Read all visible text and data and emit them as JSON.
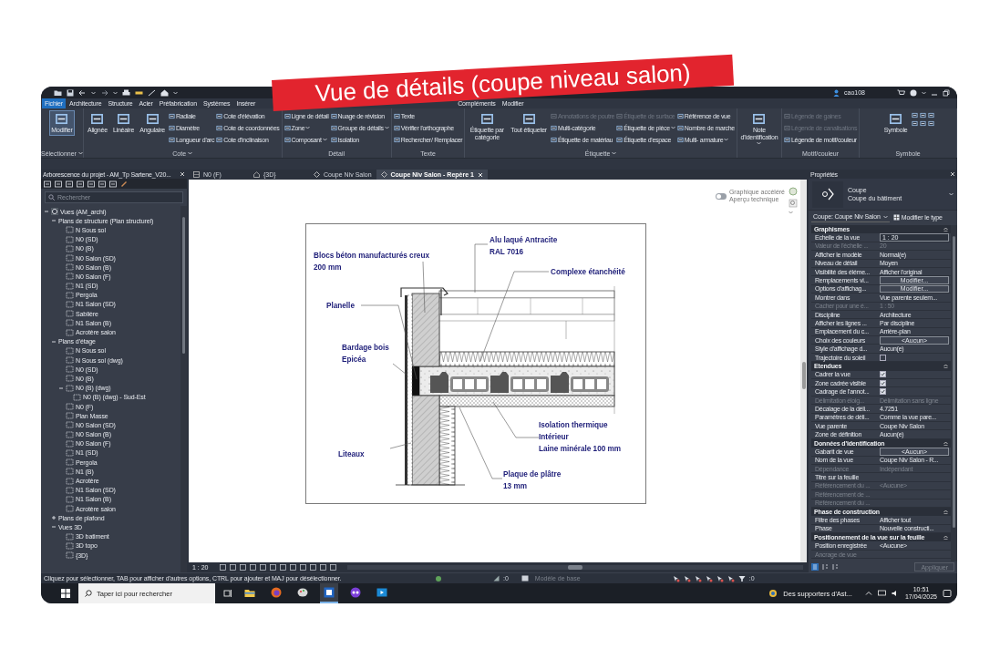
{
  "banner": "Vue de détails (coupe niveau salon)",
  "quick_access": {
    "user": "cao108"
  },
  "menu_tabs": [
    {
      "label": "Fichier",
      "selected": true
    },
    {
      "label": "Architecture",
      "selected": false
    },
    {
      "label": "Structure",
      "selected": false
    },
    {
      "label": "Acier",
      "selected": false
    },
    {
      "label": "Préfabrication",
      "selected": false
    },
    {
      "label": "Systèmes",
      "selected": false
    },
    {
      "label": "Insérer",
      "selected": false
    }
  ],
  "context_tabs": [
    {
      "label": "Compléments",
      "selected": false
    },
    {
      "label": "Modifier",
      "selected": false
    }
  ],
  "ribbon": [
    {
      "title": "Sélectionner",
      "dropdown": true,
      "buttons": [
        {
          "label": "Modifier",
          "kind": "large",
          "active": true,
          "disabled": false,
          "dropdown": false
        }
      ]
    },
    {
      "title": "Cote",
      "dropdown": true,
      "buttons": [
        {
          "label": "Alignée",
          "kind": "large",
          "active": false,
          "disabled": false,
          "dropdown": false
        },
        {
          "label": "Linéaire",
          "kind": "large",
          "active": false,
          "disabled": false,
          "dropdown": false
        },
        {
          "label": "Angulaire",
          "kind": "large",
          "active": false,
          "disabled": false,
          "dropdown": false
        },
        {
          "label": "Radiale",
          "kind": "small",
          "active": false,
          "disabled": false,
          "dropdown": false
        },
        {
          "label": "Diamètre",
          "kind": "small",
          "active": false,
          "disabled": false,
          "dropdown": false
        },
        {
          "label": "Longueur d'arc",
          "kind": "small",
          "active": false,
          "disabled": false,
          "dropdown": false
        },
        {
          "label": "Cote d'élévation",
          "kind": "small",
          "active": false,
          "disabled": false,
          "dropdown": false
        },
        {
          "label": "Cote de coordonnées",
          "kind": "small",
          "active": false,
          "disabled": false,
          "dropdown": false
        },
        {
          "label": "Cote d'inclinaison",
          "kind": "small",
          "active": false,
          "disabled": false,
          "dropdown": false
        }
      ]
    },
    {
      "title": "Détail",
      "dropdown": false,
      "buttons": [
        {
          "label": "Ligne de détail",
          "kind": "small",
          "active": false,
          "disabled": false,
          "dropdown": false
        },
        {
          "label": "Zone",
          "kind": "small",
          "active": false,
          "disabled": false,
          "dropdown": true
        },
        {
          "label": "Composant",
          "kind": "small",
          "active": false,
          "disabled": false,
          "dropdown": true
        },
        {
          "label": "Nuage de révision",
          "kind": "small",
          "active": false,
          "disabled": false,
          "dropdown": false
        },
        {
          "label": "Groupe de détails",
          "kind": "small",
          "active": false,
          "disabled": false,
          "dropdown": true
        },
        {
          "label": "Isolation",
          "kind": "small",
          "active": false,
          "disabled": false,
          "dropdown": false
        }
      ]
    },
    {
      "title": "Texte",
      "dropdown": false,
      "buttons": [
        {
          "label": "Texte",
          "kind": "small",
          "active": false,
          "disabled": false,
          "dropdown": false
        },
        {
          "label": "Vérifier l'orthographe",
          "kind": "small",
          "active": false,
          "disabled": false,
          "dropdown": false
        },
        {
          "label": "Rechercher/ Remplacer",
          "kind": "small",
          "active": false,
          "disabled": false,
          "dropdown": false
        }
      ]
    },
    {
      "title": "Étiquette",
      "dropdown": true,
      "buttons": [
        {
          "label": "Étiquette par catégorie",
          "kind": "large",
          "active": false,
          "disabled": false,
          "dropdown": false
        },
        {
          "label": "Tout étiqueter",
          "kind": "large",
          "active": false,
          "disabled": false,
          "dropdown": false
        },
        {
          "label": "Annotations de poutre",
          "kind": "small",
          "active": false,
          "disabled": true,
          "dropdown": false
        },
        {
          "label": "Multi-catégorie",
          "kind": "small",
          "active": false,
          "disabled": false,
          "dropdown": false
        },
        {
          "label": "Étiquette de matériau",
          "kind": "small",
          "active": false,
          "disabled": false,
          "dropdown": false
        },
        {
          "label": "Étiquette de surface",
          "kind": "small",
          "active": false,
          "disabled": true,
          "dropdown": false
        },
        {
          "label": "Étiquette de pièce",
          "kind": "small",
          "active": false,
          "disabled": false,
          "dropdown": true
        },
        {
          "label": "Étiquette d'espace",
          "kind": "small",
          "active": false,
          "disabled": false,
          "dropdown": false
        },
        {
          "label": "Référence de vue",
          "kind": "small",
          "active": false,
          "disabled": false,
          "dropdown": false
        },
        {
          "label": "Nombre de marche",
          "kind": "small",
          "active": false,
          "disabled": false,
          "dropdown": false
        },
        {
          "label": "Multi- armature",
          "kind": "small",
          "active": false,
          "disabled": false,
          "dropdown": true
        }
      ]
    },
    {
      "buttons": [
        {
          "label": "Note d'identification",
          "kind": "large",
          "active": false,
          "disabled": false,
          "dropdown": true
        }
      ]
    },
    {
      "title": "Motif/couleur",
      "dropdown": false,
      "buttons": [
        {
          "label": "Légende de gaines",
          "kind": "small",
          "active": false,
          "disabled": true,
          "dropdown": false
        },
        {
          "label": "Légende de canalisations",
          "kind": "small",
          "active": false,
          "disabled": true,
          "dropdown": false
        },
        {
          "label": "Légende de motif/couleur",
          "kind": "small",
          "active": false,
          "disabled": false,
          "dropdown": false
        }
      ]
    },
    {
      "title": "Symbole",
      "dropdown": false,
      "buttons": [
        {
          "label": "Symbole",
          "kind": "large",
          "active": false,
          "disabled": false,
          "dropdown": false
        }
      ]
    }
  ],
  "project_browser": {
    "title": "Arborescence du projet - AM_Tp Sartene_V20...",
    "search": {
      "placeholder": "Rechercher"
    },
    "tree": [
      {
        "label": "Vues (AM_archi)",
        "kind": "root",
        "expanded": true,
        "children": [
          {
            "label": "Plans de structure (Plan structurel)",
            "expanded": true,
            "children": [
              {
                "label": "N Sous sol",
                "kind": "view"
              },
              {
                "label": "N0 (SD)",
                "kind": "view"
              },
              {
                "label": "N0 (B)",
                "kind": "view"
              },
              {
                "label": "N0 Salon (SD)",
                "kind": "view"
              },
              {
                "label": "N0 Salon (B)",
                "kind": "view"
              },
              {
                "label": "N0 Salon (F)",
                "kind": "view"
              },
              {
                "label": "N1 (SD)",
                "kind": "view"
              },
              {
                "label": "Pergola",
                "kind": "view"
              },
              {
                "label": "N1 Salon (SD)",
                "kind": "view"
              },
              {
                "label": "Sablière",
                "kind": "view"
              },
              {
                "label": "N1 Salon (B)",
                "kind": "view"
              },
              {
                "label": "Acrotère salon",
                "kind": "view"
              }
            ]
          },
          {
            "label": "Plans d'étage",
            "expanded": true,
            "children": [
              {
                "label": "N Sous sol",
                "kind": "view"
              },
              {
                "label": "N Sous sol (dwg)",
                "kind": "view"
              },
              {
                "label": "N0 (SD)",
                "kind": "view"
              },
              {
                "label": "N0 (B)",
                "kind": "view"
              },
              {
                "label": "N0 (B) (dwg)",
                "kind": "view",
                "expanded": true,
                "children": [
                  {
                    "label": "N0 (B) (dwg) - Sud-Est",
                    "kind": "view"
                  }
                ]
              },
              {
                "label": "N0 (F)",
                "kind": "view"
              },
              {
                "label": "Plan Masse",
                "kind": "view"
              },
              {
                "label": "N0 Salon (SD)",
                "kind": "view"
              },
              {
                "label": "N0 Salon (B)",
                "kind": "view"
              },
              {
                "label": "N0 Salon (F)",
                "kind": "view"
              },
              {
                "label": "N1 (SD)",
                "kind": "view"
              },
              {
                "label": "Pergola",
                "kind": "view"
              },
              {
                "label": "N1 (B)",
                "kind": "view"
              },
              {
                "label": "Acrotère",
                "kind": "view"
              },
              {
                "label": "N1 Salon (SD)",
                "kind": "view"
              },
              {
                "label": "N1 Salon (B)",
                "kind": "view"
              },
              {
                "label": "Acrotère salon",
                "kind": "view"
              }
            ]
          },
          {
            "label": "Plans de plafond",
            "expanded": false
          },
          {
            "label": "Vues 3D",
            "expanded": true,
            "children": [
              {
                "label": "3D batiment",
                "kind": "view"
              },
              {
                "label": "3D topo",
                "kind": "view"
              },
              {
                "label": "{3D}",
                "kind": "view"
              }
            ]
          }
        ]
      }
    ]
  },
  "view_tabs": [
    {
      "label": "N0 (F)",
      "kind": "plan",
      "selected": false
    },
    {
      "label": "{3D}",
      "kind": "model",
      "selected": false
    },
    {
      "label": "Coupe Niv Salon",
      "kind": "section",
      "selected": false
    },
    {
      "label": "Coupe Niv Salon - Repère 1",
      "kind": "section",
      "selected": true
    }
  ],
  "canvas": {
    "graphics_toggle": {
      "on": false,
      "labels": [
        "Graphique accéléré",
        "Aperçu technique"
      ]
    },
    "detail": {
      "callouts": [
        {
          "lines": [
            "Alu laqué Antracite",
            "RAL 7016"
          ]
        },
        {
          "lines": [
            "Blocs béton manufacturés creux",
            "200 mm"
          ]
        },
        {
          "lines": [
            "Complexe étanchéité"
          ]
        },
        {
          "lines": [
            "Planelle"
          ]
        },
        {
          "lines": [
            "Bardage bois",
            "Epicéa"
          ]
        },
        {
          "lines": [
            "Isolation thermique",
            "Intérieur",
            "Laine minérale 100 mm"
          ]
        },
        {
          "lines": [
            "Liteaux"
          ]
        },
        {
          "lines": [
            "Plaque de plâtre",
            "13 mm"
          ]
        }
      ]
    }
  },
  "view_bar": {
    "scale": "1 : 20"
  },
  "properties": {
    "title": "Propriétés",
    "type_family": "Coupe",
    "type_name": "Coupe du bâtiment",
    "instance_selector": "Coupe: Coupe Niv Salon",
    "edit_type": "Modifier le type",
    "groups": [
      {
        "title": "Graphismes",
        "expanded": true,
        "rows": [
          {
            "label": "Echelle de la vue",
            "kind": "field",
            "value": "1 : 20",
            "disabled": false
          },
          {
            "label": "Valeur de l'échelle ...",
            "kind": "text",
            "value": "20",
            "disabled": true
          },
          {
            "label": "Afficher le modèle",
            "kind": "text",
            "value": "Normal(e)",
            "disabled": false
          },
          {
            "label": "Niveau de détail",
            "kind": "text",
            "value": "Moyen",
            "disabled": false
          },
          {
            "label": "Visibilité des éléme...",
            "kind": "text",
            "value": "Afficher l'original",
            "disabled": false
          },
          {
            "label": "Remplacements vi...",
            "kind": "button",
            "value": "Modifier...",
            "disabled": false
          },
          {
            "label": "Options d'affichag...",
            "kind": "button",
            "value": "Modifier...",
            "disabled": false
          },
          {
            "label": "Montrer dans",
            "kind": "text",
            "value": "Vue parente seulem...",
            "disabled": false
          },
          {
            "label": "Cacher pour une é...",
            "kind": "text",
            "value": "1 : 50",
            "disabled": true
          },
          {
            "label": "Discipline",
            "kind": "text",
            "value": "Architecture",
            "disabled": false
          },
          {
            "label": "Afficher les lignes ...",
            "kind": "text",
            "value": "Par discipline",
            "disabled": false
          },
          {
            "label": "Emplacement du c...",
            "kind": "text",
            "value": "Arrière-plan",
            "disabled": false
          },
          {
            "label": "Choix des couleurs",
            "kind": "button",
            "value": "<Aucun>",
            "disabled": false
          },
          {
            "label": "Style d'affichage d...",
            "kind": "text",
            "value": "Aucun(e)",
            "disabled": false
          },
          {
            "label": "Trajectoire du soleil",
            "kind": "checkbox",
            "checked": false,
            "disabled": false
          }
        ]
      },
      {
        "title": "Etendues",
        "expanded": true,
        "rows": [
          {
            "label": "Cadrer la vue",
            "kind": "checkbox",
            "checked": true,
            "disabled": false
          },
          {
            "label": "Zone cadrée visible",
            "kind": "checkbox",
            "checked": true,
            "disabled": false
          },
          {
            "label": "Cadrage de l'annot...",
            "kind": "checkbox",
            "checked": true,
            "disabled": false
          },
          {
            "label": "Délimitation éloig...",
            "kind": "text",
            "value": "Délimitation sans ligne",
            "disabled": true
          },
          {
            "label": "Décalage de la déli...",
            "kind": "text",
            "value": "4.7251",
            "disabled": false
          },
          {
            "label": "Paramètres de déli...",
            "kind": "text",
            "value": "Comme la vue pare...",
            "disabled": false
          },
          {
            "label": "Vue parente",
            "kind": "text",
            "value": "Coupe Niv Salon",
            "disabled": false
          },
          {
            "label": "Zone de définition",
            "kind": "text",
            "value": "Aucun(e)",
            "disabled": false
          }
        ]
      },
      {
        "title": "Données d'identification",
        "expanded": true,
        "rows": [
          {
            "label": "Gabarit de vue",
            "kind": "button",
            "value": "<Aucun>",
            "disabled": false
          },
          {
            "label": "Nom de la vue",
            "kind": "text",
            "value": "Coupe Niv Salon - R...",
            "disabled": false
          },
          {
            "label": "Dépendance",
            "kind": "text",
            "value": "Indépendant",
            "disabled": true
          },
          {
            "label": "Titre sur la feuille",
            "kind": "text",
            "disabled": false
          },
          {
            "label": "Référencement du ...",
            "kind": "text",
            "value": "<Aucune>",
            "disabled": true
          },
          {
            "label": "Référencement de ...",
            "kind": "text",
            "disabled": true
          },
          {
            "label": "Référencement du ...",
            "kind": "text",
            "disabled": true
          }
        ]
      },
      {
        "title": "Phase de construction",
        "expanded": true,
        "rows": [
          {
            "label": "Filtre des phases",
            "kind": "text",
            "value": "Afficher tout",
            "disabled": false
          },
          {
            "label": "Phase",
            "kind": "text",
            "value": "Nouvelle constructi...",
            "disabled": false
          }
        ]
      },
      {
        "title": "Positionnement de la vue sur la feuille",
        "expanded": true,
        "rows": [
          {
            "label": "Position enregistrée",
            "kind": "text",
            "value": "<Aucune>",
            "disabled": false
          },
          {
            "label": "Ancrage de vue",
            "kind": "text",
            "disabled": true
          }
        ]
      }
    ],
    "apply": {
      "label": "Appliquer",
      "disabled": true
    }
  },
  "status_bar": {
    "hint": "Cliquez pour sélectionner, TAB pour afficher d'autres options, CTRL pour ajouter et MAJ pour désélectionner.",
    "count": ":0",
    "model": "Modèle de base",
    "filter_count": ":0"
  },
  "taskbar": {
    "search": {
      "placeholder": "Taper ici pour rechercher"
    },
    "weather": "Des supporters d'Ast...",
    "time": "10:51",
    "date": "17/04/2025"
  }
}
